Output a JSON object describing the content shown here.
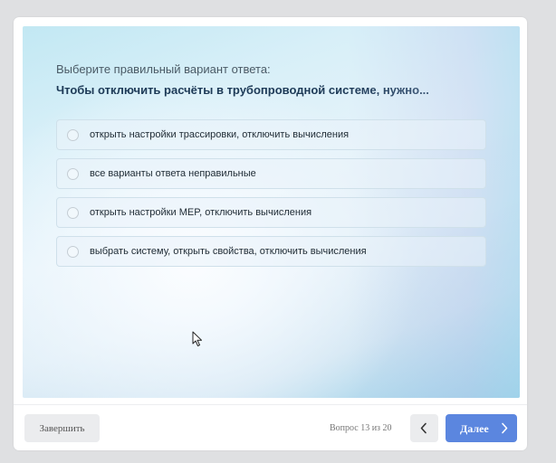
{
  "quiz": {
    "prompt": "Выберите правильный вариант ответа:",
    "question": "Чтобы отключить расчёты в трубопроводной системе, нужно...",
    "options": [
      {
        "label": "открыть настройки трассировки, отключить вычисления",
        "selected": false
      },
      {
        "label": "все варианты ответа неправильные",
        "selected": false
      },
      {
        "label": "открыть настройки MEP, отключить вычисления",
        "selected": false
      },
      {
        "label": "выбрать систему, открыть свойства, отключить вычисления",
        "selected": false
      }
    ]
  },
  "footer": {
    "finish_label": "Завершить",
    "progress_text": "Вопрос 13 из 20",
    "next_label": "Далее"
  },
  "colors": {
    "accent": "#5b86df",
    "question_text": "#1d3a57"
  },
  "icons": {
    "prev": "chevron-left-icon",
    "next": "chevron-right-icon",
    "cursor": "mouse-pointer-icon"
  }
}
